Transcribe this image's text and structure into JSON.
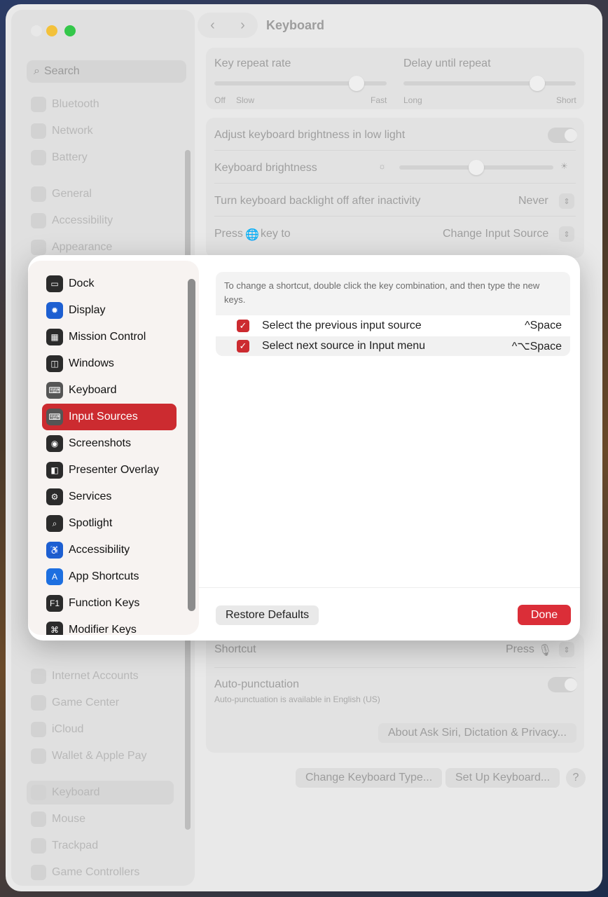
{
  "window": {
    "title": "Keyboard"
  },
  "sidebar": {
    "search_placeholder": "Search",
    "items": [
      {
        "label": "Bluetooth",
        "icon": "bluetooth-icon"
      },
      {
        "label": "Network",
        "icon": "globe-icon"
      },
      {
        "label": "Battery",
        "icon": "battery-icon"
      },
      {
        "label": "General",
        "icon": "gear-icon"
      },
      {
        "label": "Accessibility",
        "icon": "accessibility-icon"
      },
      {
        "label": "Appearance",
        "icon": "appearance-icon"
      },
      {
        "label": "Internet Accounts",
        "icon": "at-icon"
      },
      {
        "label": "Game Center",
        "icon": "game-center-icon"
      },
      {
        "label": "iCloud",
        "icon": "cloud-icon"
      },
      {
        "label": "Wallet & Apple Pay",
        "icon": "wallet-icon"
      },
      {
        "label": "Keyboard",
        "icon": "keyboard-icon"
      },
      {
        "label": "Mouse",
        "icon": "mouse-icon"
      },
      {
        "label": "Trackpad",
        "icon": "trackpad-icon"
      },
      {
        "label": "Game Controllers",
        "icon": "gamepad-icon"
      }
    ]
  },
  "keyboard": {
    "key_repeat_rate": "Key repeat rate",
    "delay_until_repeat": "Delay until repeat",
    "repeat_off": "Off",
    "repeat_slow": "Slow",
    "repeat_fast": "Fast",
    "delay_long": "Long",
    "delay_short": "Short",
    "adjust_brightness": "Adjust keyboard brightness in low light",
    "keyboard_brightness": "Keyboard brightness",
    "backlight_off": "Turn keyboard backlight off after inactivity",
    "backlight_value": "Never",
    "press_key_pre": "Press",
    "press_key_post": "key to",
    "press_key_value": "Change Input Source",
    "shortcut_label": "Shortcut",
    "shortcut_value": "Press",
    "auto_punct": "Auto-punctuation",
    "auto_punct_note": "Auto-punctuation is available in English (US)",
    "about_siri": "About Ask Siri, Dictation & Privacy...",
    "change_type": "Change Keyboard Type...",
    "set_up": "Set Up Keyboard...",
    "help": "?"
  },
  "modal": {
    "categories": [
      {
        "label": "Dock",
        "icon": "dock-icon",
        "glyph": "▭"
      },
      {
        "label": "Display",
        "icon": "display-brightness-icon",
        "glyph": "✹"
      },
      {
        "label": "Mission Control",
        "icon": "mission-control-icon",
        "glyph": "▦"
      },
      {
        "label": "Windows",
        "icon": "windows-icon",
        "glyph": "◫"
      },
      {
        "label": "Keyboard",
        "icon": "keyboard-icon",
        "glyph": "⌨"
      },
      {
        "label": "Input Sources",
        "icon": "input-sources-icon",
        "glyph": "⌨"
      },
      {
        "label": "Screenshots",
        "icon": "camera-icon",
        "glyph": "◉"
      },
      {
        "label": "Presenter Overlay",
        "icon": "presenter-overlay-icon",
        "glyph": "◧"
      },
      {
        "label": "Services",
        "icon": "gears-icon",
        "glyph": "⚙"
      },
      {
        "label": "Spotlight",
        "icon": "magnifier-icon",
        "glyph": "⌕"
      },
      {
        "label": "Accessibility",
        "icon": "accessibility-icon",
        "glyph": "♿"
      },
      {
        "label": "App Shortcuts",
        "icon": "app-store-icon",
        "glyph": "A"
      },
      {
        "label": "Function Keys",
        "icon": "f1-key-icon",
        "glyph": "F1"
      },
      {
        "label": "Modifier Keys",
        "icon": "command-key-icon",
        "glyph": "⌘"
      }
    ],
    "selected_index": 5,
    "description": "To change a shortcut, double click the key combination, and then type the new keys.",
    "shortcuts": [
      {
        "label": "Select the previous input source",
        "keys": "^Space",
        "checked": true
      },
      {
        "label": "Select next source in Input menu",
        "keys": "^⌥Space",
        "checked": true
      }
    ],
    "restore_label": "Restore Defaults",
    "done_label": "Done"
  },
  "colors": {
    "accent": "#cc2b30",
    "done": "#db2e38"
  }
}
